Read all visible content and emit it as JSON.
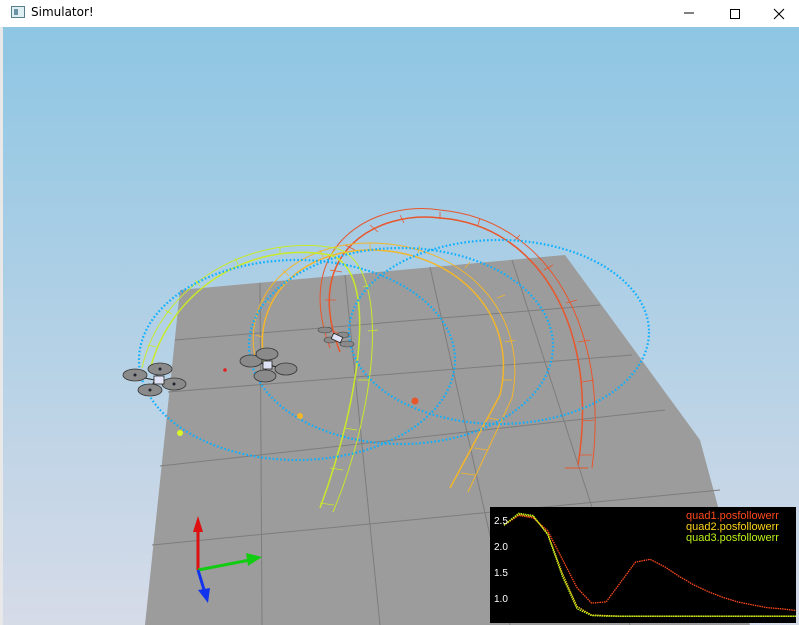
{
  "window": {
    "title": "Simulator!",
    "controls": {
      "minimize": "minimize-icon",
      "maximize": "maximize-icon",
      "close": "close-icon"
    }
  },
  "scene": {
    "sky_top": "#8ec6e3",
    "sky_bottom": "#d6dbe8",
    "floor_color": "#9c9c9c",
    "circle_color": "#0ab0ff",
    "trajectory_colors": [
      "#e8562c",
      "#f2b62b",
      "#c8ea2a"
    ],
    "axis_colors": {
      "x": "#11cc11",
      "y": "#dd1111",
      "z": "#1133ee"
    }
  },
  "plot": {
    "background": "#000000",
    "legend": [
      {
        "label": "quad1.posfollowerr",
        "color": "#ff4a1c"
      },
      {
        "label": "quad2.posfollowerr",
        "color": "#ffd319"
      },
      {
        "label": "quad3.posfollowerr",
        "color": "#bff319"
      }
    ],
    "y_ticks": [
      "2.5",
      "2.0",
      "1.5",
      "1.0"
    ]
  },
  "chart_data": {
    "type": "line",
    "ylim": [
      0.8,
      2.7
    ],
    "x": [
      0,
      5,
      10,
      15,
      20,
      25,
      30,
      35,
      40,
      45,
      50,
      55,
      60,
      65,
      70,
      75,
      80,
      85,
      90,
      95,
      100
    ],
    "series": [
      {
        "name": "quad1.posfollowerr",
        "values": [
          2.45,
          2.62,
          2.58,
          2.35,
          1.85,
          1.35,
          1.08,
          1.1,
          1.45,
          1.8,
          1.85,
          1.72,
          1.55,
          1.4,
          1.28,
          1.18,
          1.1,
          1.05,
          1.0,
          0.98,
          0.95
        ]
      },
      {
        "name": "quad2.posfollowerr",
        "values": [
          2.45,
          2.64,
          2.6,
          2.3,
          1.6,
          1.02,
          0.87,
          0.86,
          0.85,
          0.85,
          0.85,
          0.85,
          0.85,
          0.85,
          0.85,
          0.85,
          0.85,
          0.85,
          0.85,
          0.85,
          0.85
        ]
      },
      {
        "name": "quad3.posfollowerr",
        "values": [
          2.45,
          2.66,
          2.62,
          2.28,
          1.55,
          0.98,
          0.86,
          0.85,
          0.85,
          0.85,
          0.85,
          0.85,
          0.85,
          0.85,
          0.85,
          0.85,
          0.85,
          0.85,
          0.85,
          0.85,
          0.85
        ]
      }
    ]
  }
}
